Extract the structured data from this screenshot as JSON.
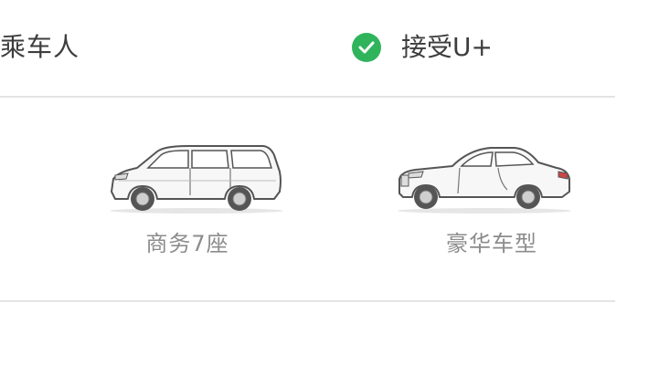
{
  "header": {
    "passenger_label": "乘车人",
    "accept_label": "接受U+",
    "accept_checked": true,
    "accept_color": "#2fb45b"
  },
  "car_types": [
    {
      "label": "商务7座",
      "icon": "mpv-car-icon"
    },
    {
      "label": "豪华车型",
      "icon": "luxury-car-icon"
    }
  ]
}
